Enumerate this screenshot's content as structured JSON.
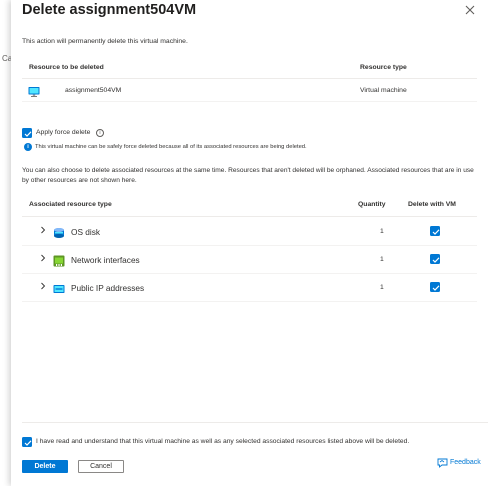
{
  "background": {
    "partial_text": "Ca"
  },
  "dialog": {
    "title": "Delete assignment504VM",
    "intro": "This action will permanently delete this virtual machine."
  },
  "resource_table": {
    "headers": {
      "resource": "Resource to be deleted",
      "type": "Resource type"
    },
    "row": {
      "name": "assignment504VM",
      "type": "Virtual machine",
      "icon": "vm-monitor-icon"
    }
  },
  "force_delete": {
    "label": "Apply force delete",
    "checked": true,
    "info_icon": "info-icon",
    "note": "This virtual machine can be safely force deleted because all of its associated resources are being deleted."
  },
  "associated": {
    "description": "You can also choose to delete associated resources at the same time. Resources that aren't deleted will be orphaned. Associated resources that are in use by other resources are not shown here.",
    "headers": {
      "type": "Associated resource type",
      "quantity": "Quantity",
      "delete": "Delete with VM"
    },
    "rows": [
      {
        "label": "OS disk",
        "quantity": "1",
        "checked": true,
        "icon": "disk-icon"
      },
      {
        "label": "Network interfaces",
        "quantity": "1",
        "checked": true,
        "icon": "network-interface-icon"
      },
      {
        "label": "Public IP addresses",
        "quantity": "1",
        "checked": true,
        "icon": "public-ip-icon"
      }
    ]
  },
  "confirm": {
    "checked": true,
    "text": "I have read and understand that this virtual machine as well as any selected associated resources listed above will be deleted."
  },
  "buttons": {
    "delete": "Delete",
    "cancel": "Cancel"
  },
  "feedback": {
    "label": "Feedback",
    "icon": "feedback-icon"
  },
  "colors": {
    "accent": "#0078d4",
    "text": "#323130",
    "border": "#edebe9"
  }
}
